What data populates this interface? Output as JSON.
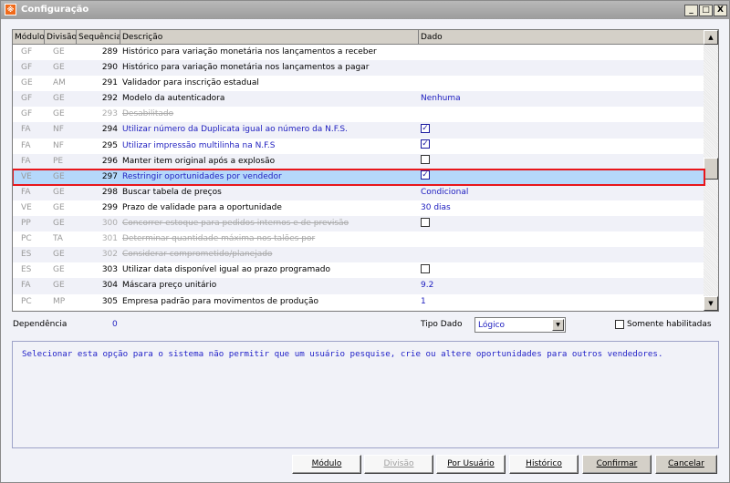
{
  "window": {
    "title": "Configuração",
    "icon": "app-logo-icon",
    "controls": [
      "_",
      "□",
      "X"
    ]
  },
  "grid": {
    "columns": [
      "Módulo",
      "Divisão",
      "Sequência",
      "Descrição",
      "Dado"
    ],
    "rows": [
      {
        "modulo": "GF",
        "divisao": "GE",
        "seq": "289",
        "desc": "Histórico para variação monetária nos lançamentos a receber",
        "dado": "",
        "style": "normal"
      },
      {
        "modulo": "GF",
        "divisao": "GE",
        "seq": "290",
        "desc": "Histórico para variação monetária nos lançamentos a pagar",
        "dado": "",
        "style": "normal"
      },
      {
        "modulo": "GE",
        "divisao": "AM",
        "seq": "291",
        "desc": "Validador para inscrição estadual",
        "dado": "",
        "style": "normal"
      },
      {
        "modulo": "GF",
        "divisao": "GE",
        "seq": "292",
        "desc": "Modelo da autenticadora",
        "dado": "Nenhuma",
        "style": "normal"
      },
      {
        "modulo": "GF",
        "divisao": "GE",
        "seq": "293",
        "desc": "Desabilitado",
        "dado": "",
        "style": "disabled"
      },
      {
        "modulo": "FA",
        "divisao": "NF",
        "seq": "294",
        "desc": "Utilizar número da Duplicata igual ao número da N.F.S.",
        "checkbox": true,
        "checked": true,
        "style": "blue"
      },
      {
        "modulo": "FA",
        "divisao": "NF",
        "seq": "295",
        "desc": "Utilizar impressão multilinha na N.F.S",
        "checkbox": true,
        "checked": true,
        "style": "blue"
      },
      {
        "modulo": "FA",
        "divisao": "PE",
        "seq": "296",
        "desc": "Manter item original após a explosão",
        "checkbox": true,
        "checked": false,
        "style": "normal"
      },
      {
        "modulo": "VE",
        "divisao": "GE",
        "seq": "297",
        "desc": "Restringir oportunidades por vendedor",
        "checkbox": true,
        "checked": true,
        "style": "blue",
        "selected": true
      },
      {
        "modulo": "FA",
        "divisao": "GE",
        "seq": "298",
        "desc": "Buscar tabela de preços",
        "dado": "Condicional",
        "style": "normal"
      },
      {
        "modulo": "VE",
        "divisao": "GE",
        "seq": "299",
        "desc": "Prazo de validade para a oportunidade",
        "dado": "30 dias",
        "style": "normal"
      },
      {
        "modulo": "PP",
        "divisao": "GE",
        "seq": "300",
        "desc": "Concorrer estoque para pedidos internos e de previsão",
        "checkbox": true,
        "checked": false,
        "style": "disabled"
      },
      {
        "modulo": "PC",
        "divisao": "TA",
        "seq": "301",
        "desc": "Determinar quantidade máxima nos talões por",
        "dado": "",
        "style": "disabled"
      },
      {
        "modulo": "ES",
        "divisao": "GE",
        "seq": "302",
        "desc": "Considerar comprometido/planejado",
        "dado": "",
        "style": "disabled"
      },
      {
        "modulo": "ES",
        "divisao": "GE",
        "seq": "303",
        "desc": "Utilizar data disponível igual ao prazo programado",
        "checkbox": true,
        "checked": false,
        "style": "normal"
      },
      {
        "modulo": "FA",
        "divisao": "GE",
        "seq": "304",
        "desc": "Máscara preço unitário",
        "dado": "9.2",
        "style": "normal"
      },
      {
        "modulo": "PC",
        "divisao": "MP",
        "seq": "305",
        "desc": "Empresa padrão para movimentos de produção",
        "dado": "1",
        "style": "normal"
      }
    ]
  },
  "details": {
    "dependencia_label": "Dependência",
    "dependencia_value": "0",
    "tipo_dado_label": "Tipo Dado",
    "tipo_dado_value": "Lógico",
    "somente_habilitadas_label": "Somente habilitadas",
    "somente_habilitadas_checked": false,
    "description": "Selecionar esta opção para o sistema não permitir que um usuário pesquise, crie ou altere oportunidades para outros vendedores."
  },
  "buttons": {
    "modulo": "Módulo",
    "divisao": "Divisão",
    "por_usuario": "Por Usuário",
    "historico": "Histórico",
    "confirmar": "Confirmar",
    "cancelar": "Cancelar"
  },
  "colors": {
    "selection": "#b5d8fb",
    "highlight_border": "#e8161b",
    "data_text": "#2020c0"
  }
}
